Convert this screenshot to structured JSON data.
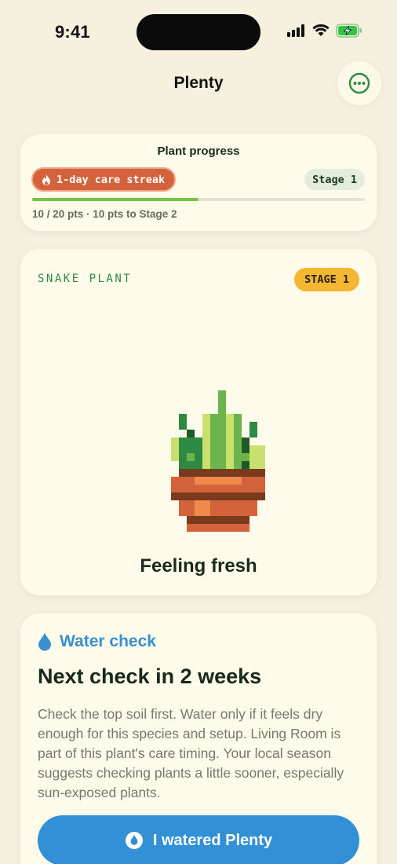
{
  "status_bar": {
    "time": "9:41",
    "icons": [
      "cellular-signal-icon",
      "wifi-icon",
      "battery-charging-icon"
    ]
  },
  "nav": {
    "title": "Plenty",
    "more_icon": "ellipsis-circle-icon"
  },
  "progress": {
    "title": "Plant progress",
    "streak_label": "1-day care streak",
    "streak_icon": "flame-icon",
    "stage_label": "Stage 1",
    "points_current": 10,
    "points_total": 20,
    "fill_fraction": 0.5,
    "summary": "10 / 20 pts · 10 pts to Stage 2"
  },
  "plant": {
    "species": "SNAKE PLANT",
    "stage_badge": "STAGE 1",
    "mood": "Feeling fresh",
    "art_icon": "pixel-snake-plant-icon"
  },
  "water": {
    "icon": "water-drop-icon",
    "label": "Water check",
    "next_check": "Next check in 2 weeks",
    "body": "Check the top soil first. Water only if it feels dry enough for this species and setup. Living Room is part of this plant's care timing. Your local season suggests checking plants a little sooner, especially sun-exposed plants.",
    "button_label": "I watered Plenty"
  },
  "colors": {
    "background": "#f6f1df",
    "card": "#fffbea",
    "streak": "#d4623a",
    "progress_fill": "#78c240",
    "stage_badge": "#f4b731",
    "water_blue": "#3290d6",
    "species_green": "#2e8a43"
  }
}
